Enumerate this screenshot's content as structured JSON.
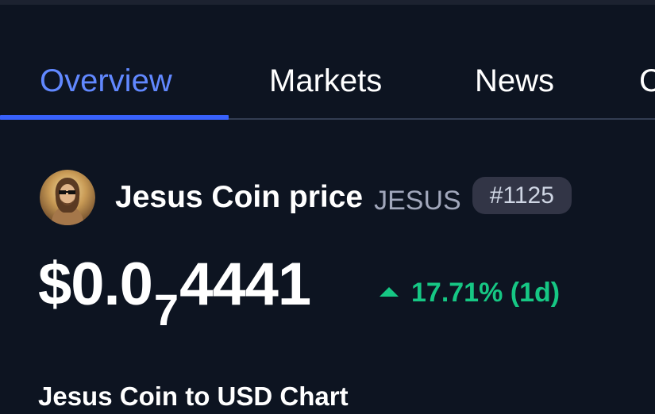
{
  "tabs": [
    {
      "label": "Overview",
      "active": true
    },
    {
      "label": "Markets",
      "active": false
    },
    {
      "label": "News",
      "active": false
    },
    {
      "label": "C",
      "active": false
    }
  ],
  "coin": {
    "name": "Jesus Coin price",
    "symbol": "JESUS",
    "rank": "#1125",
    "avatar_icon": "jesus-sunglasses-avatar-icon"
  },
  "price": {
    "prefix": "$0.0",
    "zero_count": "7",
    "significant": "4441"
  },
  "change": {
    "direction_icon": "triangle-up-icon",
    "text": "17.71% (1d)",
    "color": "#16c784"
  },
  "chart": {
    "heading": "Jesus Coin to USD Chart"
  },
  "colors": {
    "background": "#0d1421",
    "accent": "#3861fb",
    "active_tab_text": "#6188ff",
    "positive": "#16c784",
    "badge_bg": "#323546"
  }
}
